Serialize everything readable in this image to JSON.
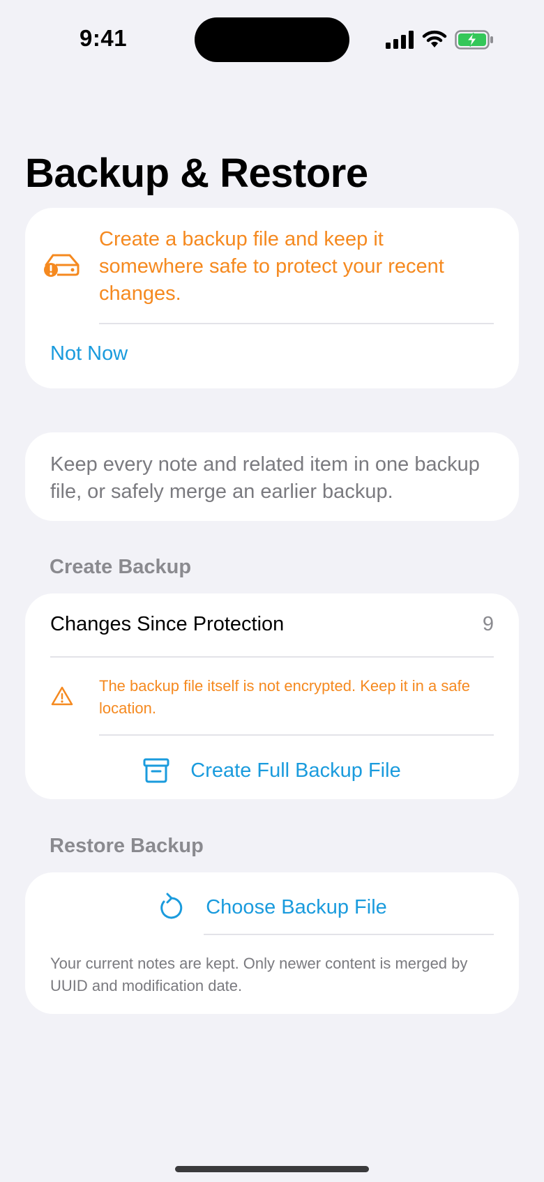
{
  "status_bar": {
    "time": "9:41"
  },
  "page": {
    "title": "Backup & Restore"
  },
  "backup_notice": {
    "message": "Create a backup file and keep it somewhere safe to protect your recent changes.",
    "dismiss_label": "Not Now",
    "icon": "external-drive-warning-icon"
  },
  "info": {
    "text": "Keep every note and related item in one backup file, or safely merge an earlier backup."
  },
  "create_backup": {
    "header": "Create Backup",
    "changes_label": "Changes Since Protection",
    "changes_count": "9",
    "warning": "The backup file itself is not encrypted. Keep it in a safe location.",
    "button_label": "Create Full Backup File",
    "button_icon": "archive-box-icon"
  },
  "restore_backup": {
    "header": "Restore Backup",
    "button_label": "Choose Backup File",
    "button_icon": "restore-arrow-icon",
    "footnote": "Your current notes are kept. Only newer content is merged by UUID and modification date."
  },
  "colors": {
    "accent": "#1a9bdd",
    "warning": "#f5891f",
    "background": "#f2f2f7",
    "battery": "#34c759"
  }
}
